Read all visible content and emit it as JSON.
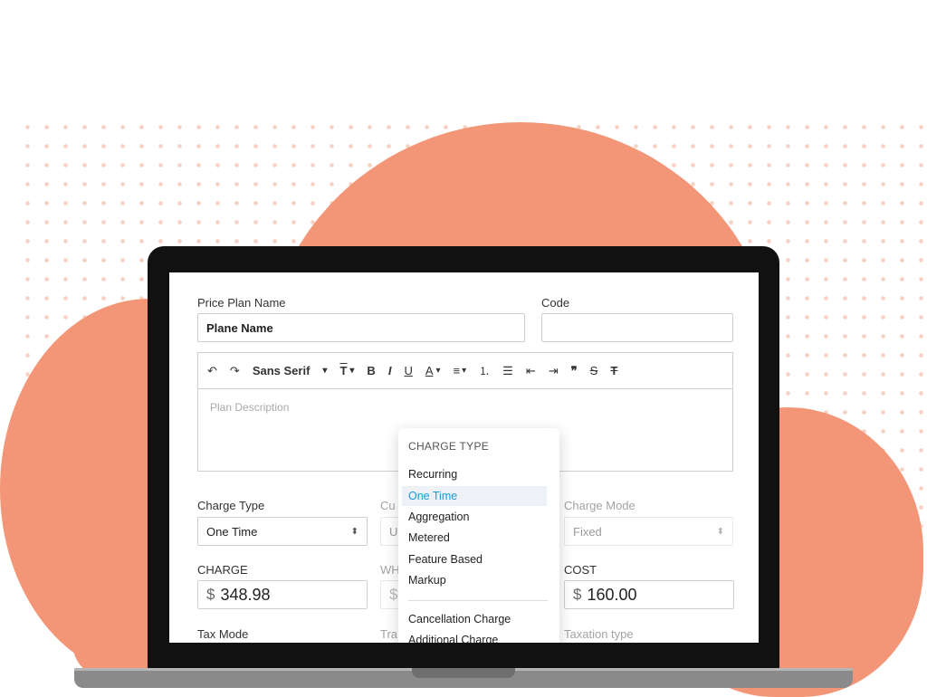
{
  "form": {
    "price_plan_name_label": "Price Plan Name",
    "price_plan_name_value": "Plane Name",
    "code_label": "Code",
    "code_value": "",
    "description_placeholder": "Plan Description",
    "charge_type_label": "Charge Type",
    "charge_type_value": "One Time",
    "currency_label_partial": "Cu",
    "currency_value_partial": "U",
    "charge_mode_label": "Charge Mode",
    "charge_mode_value": "Fixed",
    "charge_label": "CHARGE",
    "charge_currency": "$",
    "charge_value": "348.98",
    "wh_label_partial": "WH",
    "wh_currency_partial": "$",
    "cost_label": "COST",
    "cost_currency": "$",
    "cost_value": "160.00",
    "tax_mode_label": "Tax Mode",
    "tra_label_partial": "Tra",
    "taxation_type_label": "Taxation type"
  },
  "toolbar": {
    "undo_icon": "↶",
    "redo_icon": "↷",
    "font_family": "Sans Serif",
    "dropdown_caret": "▾",
    "font_size_icon": "T",
    "bold": "B",
    "italic": "I",
    "underline": "U",
    "text_color": "A",
    "align_icon": "≡",
    "ordered_list_icon": "⒈",
    "bullet_list_icon": "☰",
    "outdent_icon": "⇤",
    "indent_icon": "⇥",
    "quote_icon": "❞",
    "strike_icon": "S",
    "clear_format_icon": "T"
  },
  "dropdown": {
    "header": "CHARGE TYPE",
    "items": [
      "Recurring",
      "One Time",
      "Aggregation",
      "Metered",
      "Feature Based",
      "Markup"
    ],
    "selected": "One Time",
    "extra_items": [
      "Cancellation Charge",
      "Additional Charge"
    ]
  },
  "colors": {
    "cloud": "#f39677",
    "selected_text": "#1a9bd7"
  }
}
